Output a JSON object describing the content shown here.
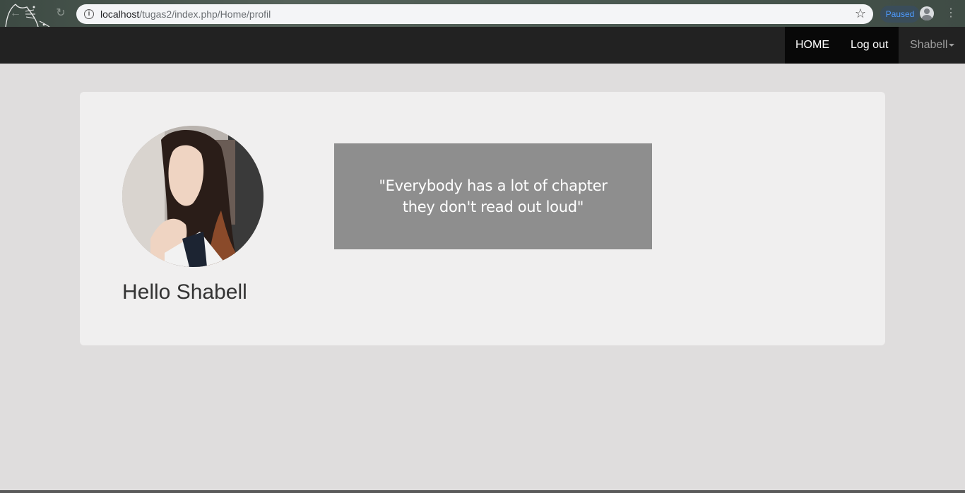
{
  "browser": {
    "url_host": "localhost",
    "url_path": "/tugas2/index.php/Home/profil",
    "paused_label": "Paused"
  },
  "navbar": {
    "links": [
      {
        "label": "HOME"
      },
      {
        "label": "Log out"
      }
    ],
    "user_menu": "Shabell"
  },
  "profile": {
    "greeting": "Hello Shabell",
    "quote_line1": "\"Everybody has a lot of chapter",
    "quote_line2": "they don't read out loud\""
  },
  "colors": {
    "navbar_bg": "#222222",
    "active_nav_bg": "#080808",
    "page_bg": "#dfdddd",
    "card_bg": "#f0efef",
    "quote_bg": "#8e8e8e",
    "paused_text": "#4e9bff"
  },
  "icons": [
    "totoro-icon",
    "back-icon",
    "reload-icon",
    "info-icon",
    "star-icon",
    "profile-icon",
    "menu-icon",
    "caret-down-icon"
  ]
}
